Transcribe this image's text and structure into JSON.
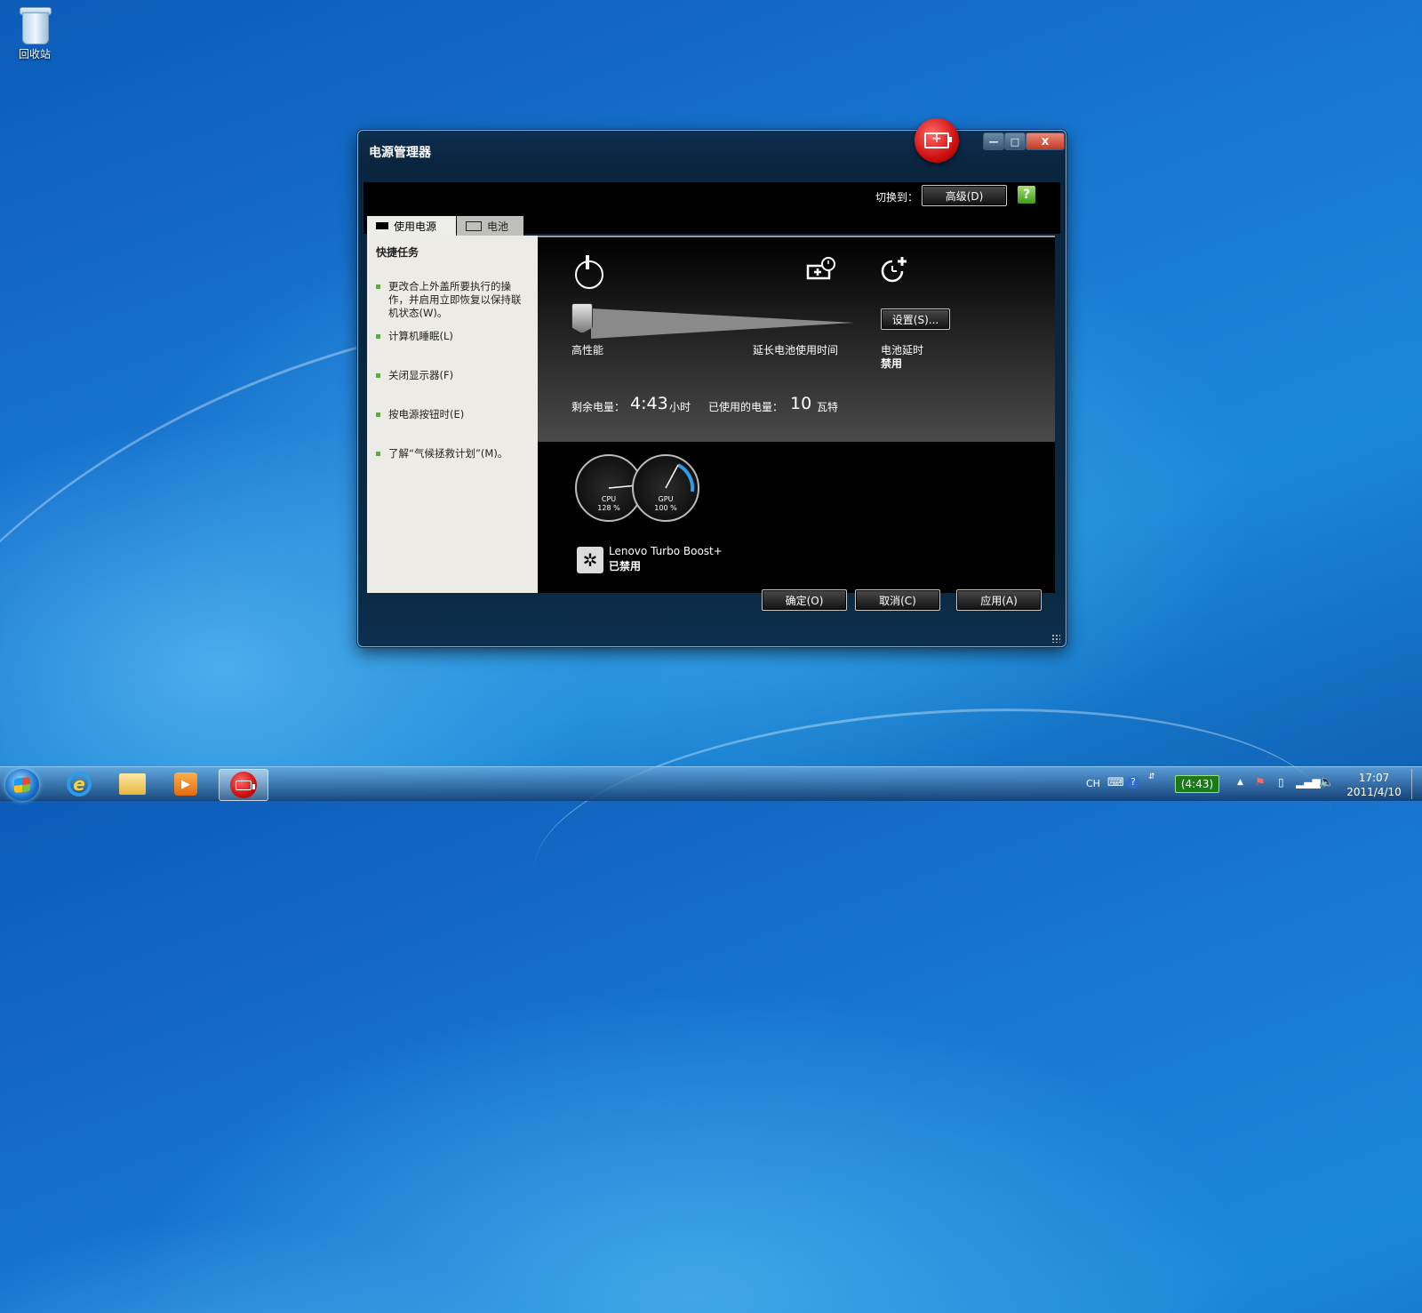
{
  "desktop": {
    "recycle_bin_label": "回收站"
  },
  "window": {
    "title": "电源管理器",
    "switch_label": "切换到：",
    "switch_button": "高级(D)",
    "tabs": [
      {
        "label": "使用电源"
      },
      {
        "label": "电池"
      }
    ],
    "quick_tasks": {
      "heading": "快捷任务",
      "items": [
        "更改合上外盖所要执行的操作，并启用立即恢复以保持联机状态(W)。",
        "计算机睡眠(L)",
        "关闭显示器(F)",
        "按电源按钮时(E)",
        "了解“气候拯救计划”(M)。"
      ]
    },
    "plan": {
      "left_label": "高性能",
      "right_label": "延长电池使用时间",
      "settings_button": "设置(S)...",
      "battery_delay_label": "电池延时",
      "battery_delay_value": "禁用",
      "remaining_label": "剩余电量：",
      "remaining_value": "4:43",
      "remaining_unit": "小时",
      "used_label": "已使用的电量：",
      "used_value": "10",
      "used_unit": "瓦特"
    },
    "gauges": [
      {
        "name": "CPU",
        "value": "128 %"
      },
      {
        "name": "GPU",
        "value": "100 %"
      }
    ],
    "turbo": {
      "title": "Lenovo Turbo Boost+",
      "status": "已禁用"
    },
    "buttons": {
      "ok": "确定(O)",
      "cancel": "取消(C)",
      "apply": "应用(A)"
    }
  },
  "taskbar": {
    "tray": {
      "input_lang": "CH",
      "battery_text": "(4:43)"
    },
    "clock": {
      "time": "17:07",
      "date": "2011/4/10"
    }
  },
  "colors": {
    "accent_red": "#d01010",
    "bullet_green": "#5ab030",
    "tray_battery": "#1a7a1a"
  }
}
